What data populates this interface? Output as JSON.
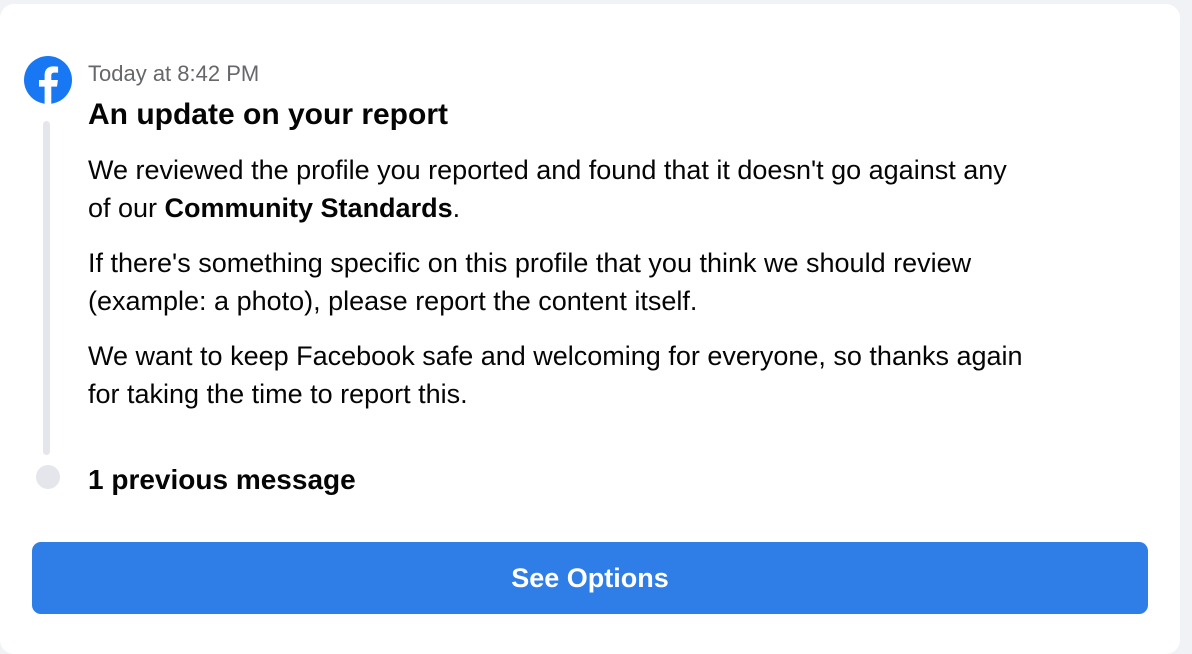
{
  "notification": {
    "timestamp": "Today at 8:42 PM",
    "title": "An update on your report",
    "para1": {
      "line1": "We reviewed the profile you reported and found that it doesn't go against any",
      "line2_prefix": "of our ",
      "line2_bold": "Community Standards",
      "line2_suffix": "."
    },
    "para2": {
      "line1": "If there's something specific on this profile that you think we should review",
      "line2": "(example: a photo), please report the content itself."
    },
    "para3": {
      "line1": "We want to keep Facebook safe and welcoming for everyone, so thanks again",
      "line2": "for taking the time to report this."
    }
  },
  "previous": {
    "label": "1 previous message"
  },
  "actions": {
    "see_options_label": "See Options"
  },
  "icons": {
    "logo": "facebook-logo-icon"
  },
  "colors": {
    "brand": "#1877f2",
    "button": "#2f7de6",
    "secondary_text": "#65676b",
    "timeline": "#e4e6eb"
  }
}
